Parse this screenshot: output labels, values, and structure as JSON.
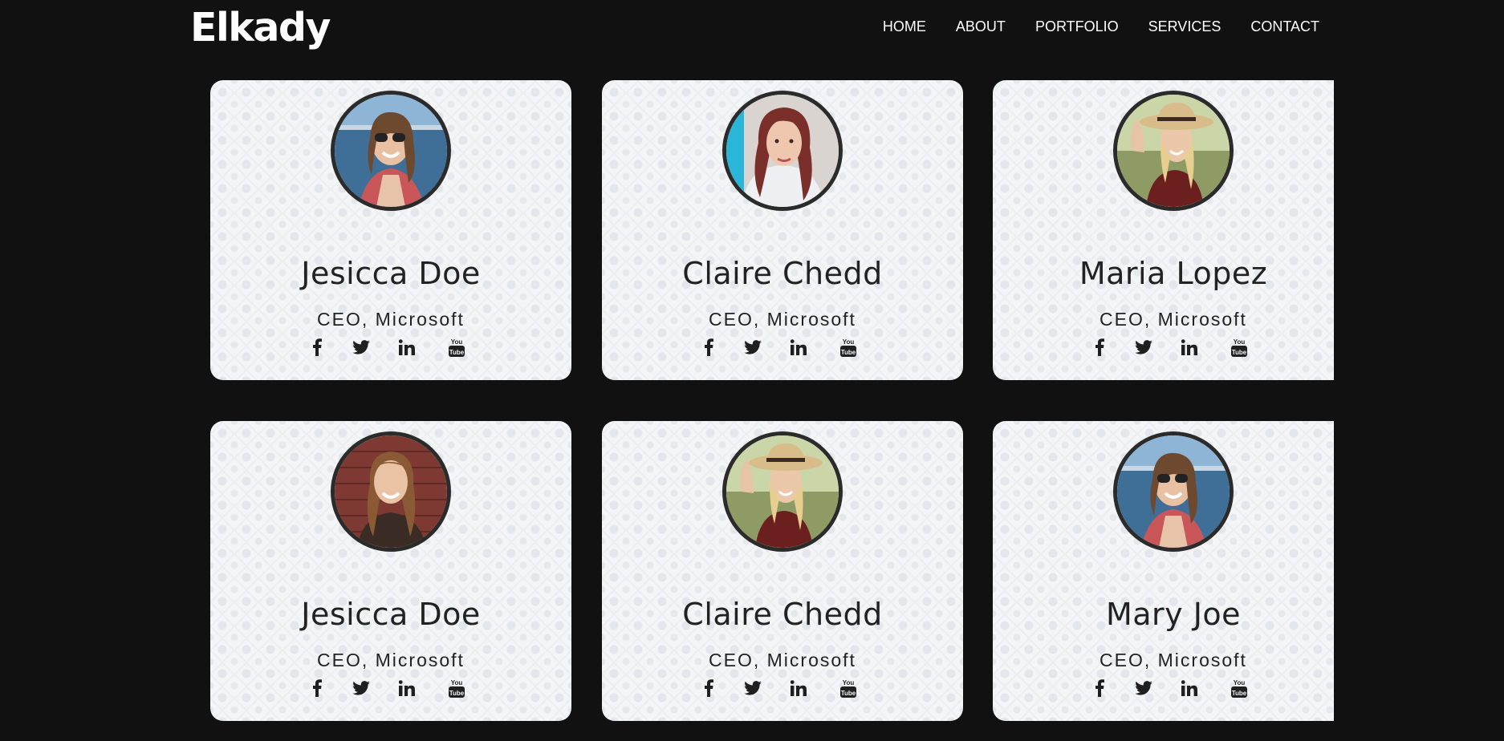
{
  "header": {
    "logo": "Elkady",
    "nav": [
      {
        "label": "HOME"
      },
      {
        "label": "ABOUT"
      },
      {
        "label": "PORTFOLIO"
      },
      {
        "label": "SERVICES"
      },
      {
        "label": "CONTACT"
      }
    ]
  },
  "cards": [
    {
      "name": "Jesicca Doe",
      "role": "CEO, Microsoft",
      "avatar": "woman-sunglasses-sea"
    },
    {
      "name": "Claire Chedd",
      "role": "CEO, Microsoft",
      "avatar": "woman-red-hair"
    },
    {
      "name": "Maria Lopez",
      "role": "CEO, Microsoft",
      "avatar": "woman-straw-hat"
    },
    {
      "name": "Jesicca Doe",
      "role": "CEO, Microsoft",
      "avatar": "woman-brick-wall"
    },
    {
      "name": "Claire Chedd",
      "role": "CEO, Microsoft",
      "avatar": "woman-straw-hat"
    },
    {
      "name": "Mary Joe",
      "role": "CEO, Microsoft",
      "avatar": "woman-sunglasses-sea"
    }
  ],
  "social_icons": [
    "facebook-icon",
    "twitter-icon",
    "linkedin-icon",
    "youtube-icon"
  ],
  "colors": {
    "page_background": "#111111",
    "card_background": "#f4f5f6",
    "text_dark": "#222222",
    "avatar_border": "#2b2b2b"
  }
}
